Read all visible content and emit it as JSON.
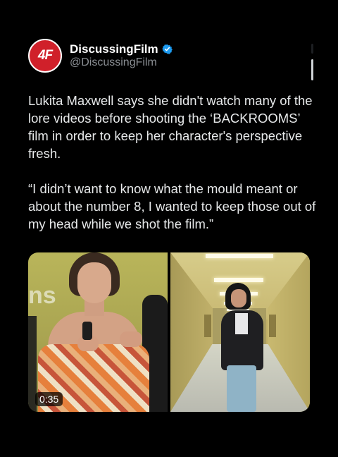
{
  "account": {
    "avatar_text": "4F",
    "display_name": "DiscussingFilm",
    "handle": "@DiscussingFilm",
    "verified": true,
    "verified_icon": "verified-badge-icon",
    "brand_color": "#d0202a",
    "verified_color": "#1d9bf0"
  },
  "tweet": {
    "paragraphs": [
      "Lukita Maxwell says she didn't watch many of the lore videos before shooting the ‘BACKROOMS’ film in order to keep her character's perspective fresh.",
      "“I didn’t want to know what the mould meant or about the number 8, I wanted to keep those out of my head while we shot the film.”"
    ]
  },
  "media": {
    "video_duration": "0:35",
    "left_backdrop_text": "ns"
  }
}
